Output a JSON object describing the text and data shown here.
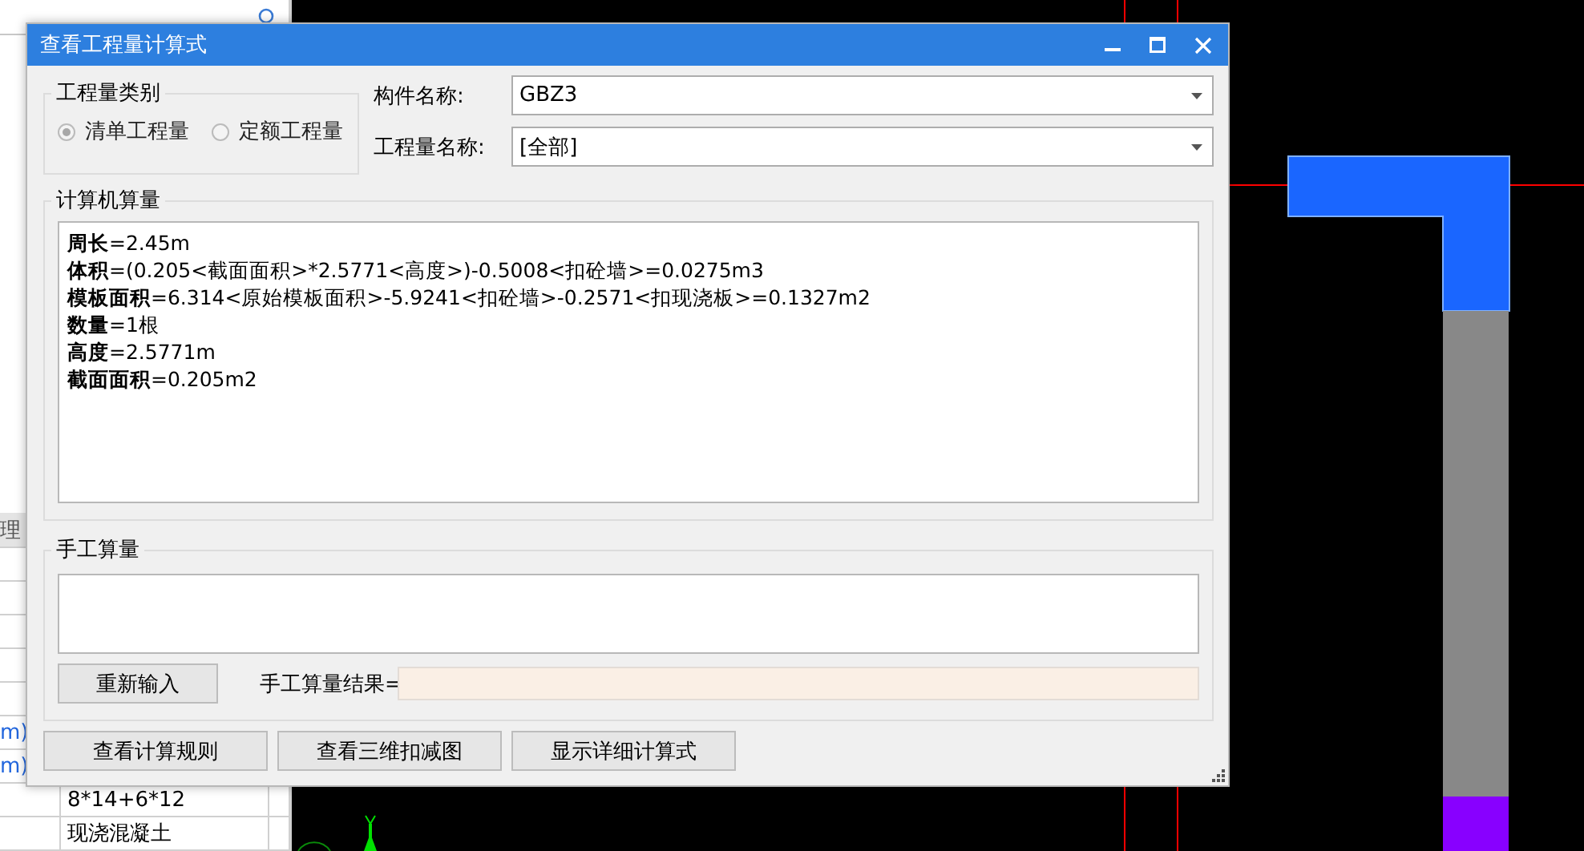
{
  "background_table": {
    "header": "理",
    "rows": [
      {
        "column_1": "m)"
      },
      {
        "column_1": "m)"
      },
      {
        "column_2": "8*14+6*12"
      },
      {
        "column_2": "现浇混凝土"
      }
    ]
  },
  "window": {
    "title": "查看工程量计算式"
  },
  "quantity_type": {
    "title": "工程量类别",
    "options": [
      {
        "label": "清单工程量",
        "selected": true
      },
      {
        "label": "定额工程量",
        "selected": false
      }
    ]
  },
  "component_name": {
    "label": "构件名称:",
    "value": "GBZ3"
  },
  "quantity_name": {
    "label": "工程量名称:",
    "value": "[全部]"
  },
  "computer_calc": {
    "title": "计算机算量",
    "lines": [
      "**周长**=2.45m",
      "**体积**=(0.205<截面面积>*2.5771<高度>)-0.5008<扣砼墙>=0.0275m3",
      "**模板面积**=6.314<原始模板面积>-5.9241<扣砼墙>-0.2571<扣现浇板>=0.1327m2",
      "**数量**=1根",
      "**高度**=2.5771m",
      "**截面面积**=0.205m2"
    ]
  },
  "manual_calc": {
    "title": "手工算量",
    "reset_button": "重新输入",
    "result_label": "手工算量结果="
  },
  "buttons": [
    "查看计算规则",
    "查看三维扣减图",
    "显示详细计算式"
  ]
}
